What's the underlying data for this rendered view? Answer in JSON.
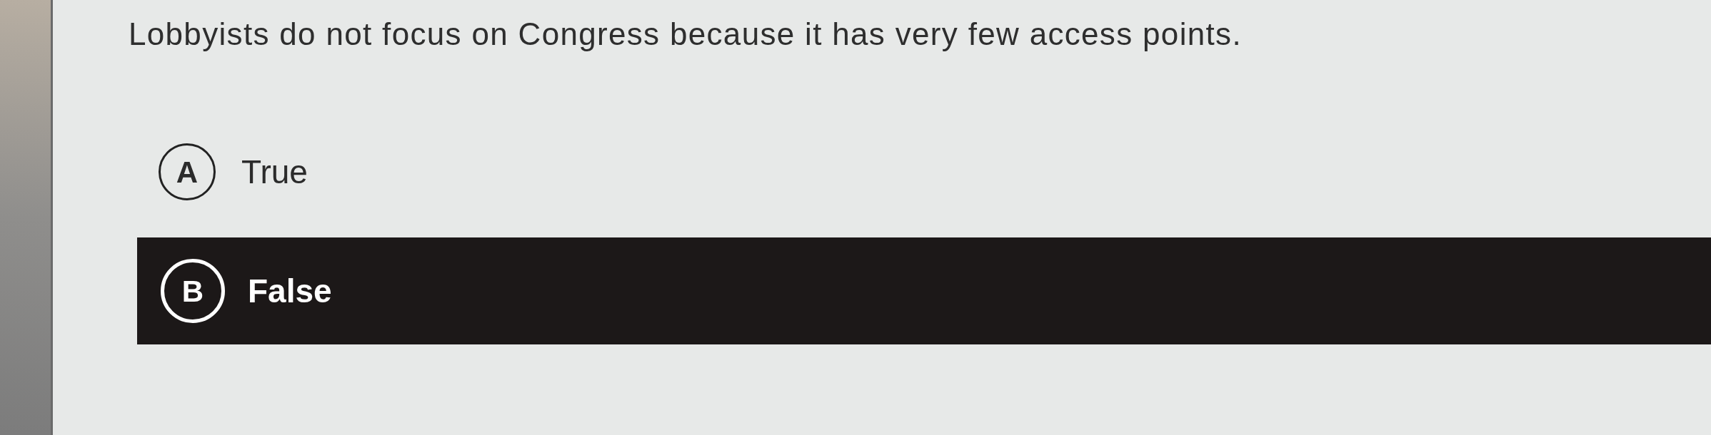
{
  "question": {
    "text": "Lobbyists do not focus on Congress because it has very few access points."
  },
  "options": [
    {
      "letter": "A",
      "label": "True",
      "selected": false
    },
    {
      "letter": "B",
      "label": "False",
      "selected": true
    }
  ]
}
